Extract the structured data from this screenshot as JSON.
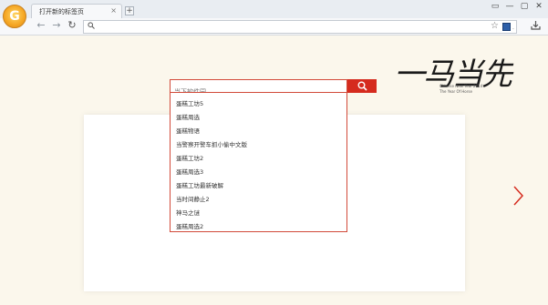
{
  "browser": {
    "tab_title": "打开新的标签页",
    "tab_close": "×",
    "new_tab": "+",
    "window_controls": [
      "▭",
      "—",
      "▢",
      "✕"
    ],
    "logo_letter": "G"
  },
  "nav": {
    "back": "←",
    "forward": "→",
    "reload": "↻",
    "address_value": "",
    "star": "☆",
    "ext_label": "."
  },
  "decoration": {
    "calligraphy": "一马当先",
    "caption_line1": "Chinese New Year 2014",
    "caption_line2": "The Year Of Horse"
  },
  "search": {
    "placeholder": "当下软件园",
    "suggestions": [
      "蛋糕工坊5",
      "蛋糕周选",
      "蛋糕物语",
      "当警察开警车抓小偷中文版",
      "蛋糕工坊2",
      "蛋糕周选3",
      "蛋糕工坊最新破解",
      "当时间静止2",
      "神马之谜",
      "蛋糕周选2"
    ]
  },
  "colors": {
    "accent": "#d52b1e",
    "border": "#d24a3a",
    "page_bg": "#fbf7ec"
  }
}
